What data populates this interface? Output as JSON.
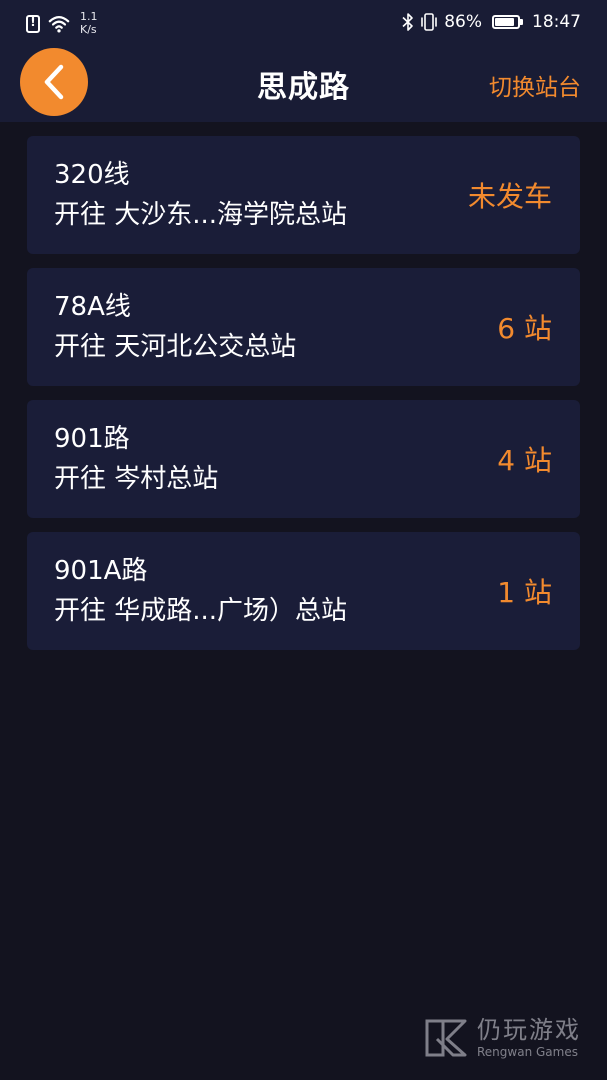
{
  "status_bar": {
    "net_speed_value": "1.1",
    "net_speed_unit": "K/s",
    "battery": "86%",
    "time": "18:47"
  },
  "header": {
    "title": "思成路",
    "switch_label": "切换站台"
  },
  "routes": [
    {
      "name": "320线",
      "destination": "开往 大沙东...海学院总站",
      "status": "未发车"
    },
    {
      "name": "78A线",
      "destination": "开往 天河北公交总站",
      "status": "6 站"
    },
    {
      "name": "901路",
      "destination": "开往 岑村总站",
      "status": "4 站"
    },
    {
      "name": "901A路",
      "destination": "开往 华成路...广场）总站",
      "status": "1 站"
    }
  ],
  "watermark": {
    "cn": "仍玩游戏",
    "en": "Rengwan Games"
  },
  "colors": {
    "background": "#13131f",
    "header": "#191c35",
    "card": "#1a1d38",
    "accent": "#f28a2e"
  }
}
